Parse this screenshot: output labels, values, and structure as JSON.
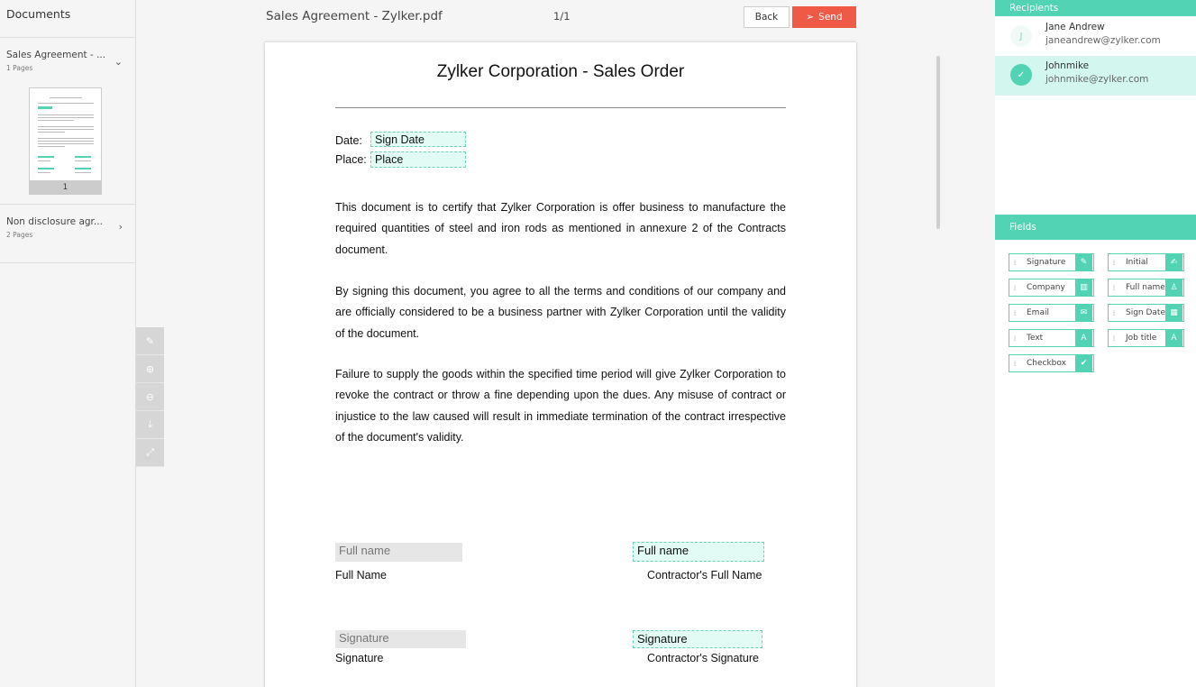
{
  "sidebar": {
    "header": "Documents",
    "documents": [
      {
        "name": "Sales Agreement - ...",
        "pages": "1 Pages",
        "thumb_page": "1"
      },
      {
        "name": "Non disclosure agr...",
        "pages": "2 Pages"
      }
    ]
  },
  "toolbar": {
    "doc_title": "Sales Agreement - Zylker.pdf",
    "page_indicator": "1/1",
    "back_label": "Back",
    "send_label": "Send"
  },
  "document": {
    "heading": "Zylker Corporation - Sales Order",
    "date_label": "Date:",
    "date_field": "Sign Date",
    "place_label": "Place:",
    "place_field": "Place",
    "paragraphs": [
      "This document is to certify that Zylker Corporation is offer business to manufacture the required quantities of steel and iron rods as mentioned in annexure 2 of the Contracts document.",
      "By signing this document, you agree to all the terms and conditions of our company and are officially considered to be a business partner with Zylker Corporation until the validity of the document.",
      "Failure to supply the goods within the specified time period will give Zylker Corporation to revoke the contract or throw a fine depending upon the dues. Any misuse of contract or injustice to the law caused will result in immediate termination of the contract irrespective of the document's validity."
    ],
    "fullname_field_left": "Full name",
    "fullname_label_left": "Full Name",
    "fullname_field_right": "Full name",
    "fullname_label_right": "Contractor's Full Name",
    "signature_field_left": "Signature",
    "signature_label_left": "Signature",
    "signature_field_right": "Signature",
    "signature_label_right": "Contractor's Signature"
  },
  "recipients": {
    "header": "Recipients",
    "list": [
      {
        "initial": "J",
        "name": "Jane Andrew",
        "email": "janeandrew@zylker.com"
      },
      {
        "initial": "✓",
        "name": "Johnmike",
        "email": "johnmike@zylker.com"
      }
    ]
  },
  "fields": {
    "header": "Fields",
    "items": [
      {
        "label": "Signature",
        "icon": "pen-icon",
        "glyph": "✎"
      },
      {
        "label": "Initial",
        "icon": "initial-icon",
        "glyph": "✍"
      },
      {
        "label": "Company",
        "icon": "building-icon",
        "glyph": "▥"
      },
      {
        "label": "Full name",
        "icon": "person-icon",
        "glyph": "♙"
      },
      {
        "label": "Email",
        "icon": "envelope-icon",
        "glyph": "✉"
      },
      {
        "label": "Sign Date",
        "icon": "calendar-icon",
        "glyph": "▦"
      },
      {
        "label": "Text",
        "icon": "text-icon",
        "glyph": "A"
      },
      {
        "label": "Job title",
        "icon": "text-icon",
        "glyph": "A"
      },
      {
        "label": "Checkbox",
        "icon": "checkbox-icon",
        "glyph": "✔"
      }
    ]
  },
  "colors": {
    "accent": "#52d3b4",
    "send": "#ef5a47",
    "field_bg": "#e2fbf5"
  }
}
